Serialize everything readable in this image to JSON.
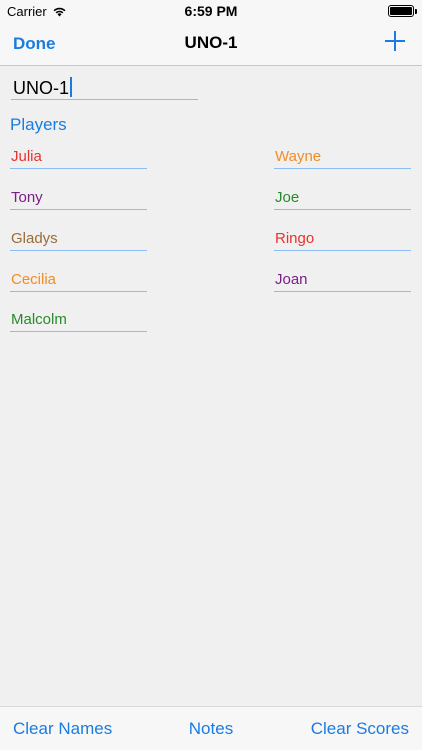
{
  "status_bar": {
    "carrier": "Carrier",
    "time": "6:59 PM",
    "battery_level": 1.0
  },
  "nav": {
    "done_label": "Done",
    "title": "UNO-1",
    "add_icon": "plus-icon"
  },
  "game": {
    "name": "UNO-1"
  },
  "players_label": "Players",
  "players": [
    {
      "name": "Julia",
      "color": "#e8322f"
    },
    {
      "name": "Wayne",
      "color": "#f28c28"
    },
    {
      "name": "Tony",
      "color": "#7c1f86"
    },
    {
      "name": "Joe",
      "color": "#2a8a2a"
    },
    {
      "name": "Gladys",
      "color": "#9b6b3a"
    },
    {
      "name": "Ringo",
      "color": "#e8322f"
    },
    {
      "name": "Cecilia",
      "color": "#f28c28"
    },
    {
      "name": "Joan",
      "color": "#7c1f86"
    },
    {
      "name": "Malcolm",
      "color": "#2a8a2a"
    }
  ],
  "toolbar": {
    "clear_names": "Clear Names",
    "notes": "Notes",
    "clear_scores": "Clear Scores"
  },
  "colors": {
    "accent": "#1a7ce2",
    "underline": "#8cbef5"
  }
}
